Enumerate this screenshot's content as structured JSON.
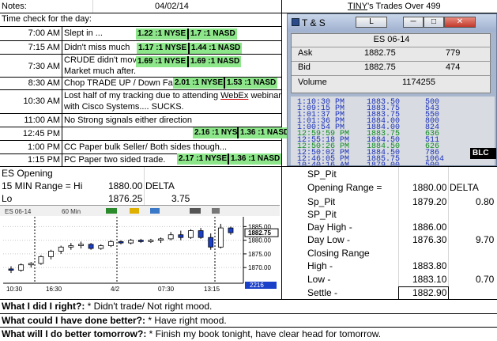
{
  "header": {
    "notes_label": "Notes:",
    "date": "04/02/14",
    "title_prefix": "TINY",
    "title_suffix": "'s Trades Over 499"
  },
  "time_check_label": "Time check for the day:",
  "log": [
    {
      "time": "7:00 AM",
      "note": "Slept in ...",
      "nyse": "1.22 :1 NYSE",
      "nasd": "1.7 :1 NASD"
    },
    {
      "time": "7:15 AM",
      "note": "Didn't miss much",
      "nyse": "1.17 :1 NYSE",
      "nasd": "1.44 :1 NASD"
    },
    {
      "time": "7:30 AM",
      "note": "CRUDE didn't move",
      "note2": "Market much after.",
      "nyse": "1.69 :1 NYSE",
      "nasd": "1.69 :1 NASD"
    },
    {
      "time": "8:30 AM",
      "note": "Chop TRADE UP / Down Fail",
      "nyse": "2.01 :1 NYSE",
      "nasd": "1.53 :1 NASD"
    },
    {
      "time": "10:30 AM",
      "note_a": "Lost half of my tracking due to attending ",
      "note_webex": "WebEx",
      "note_b": " webinar",
      "note2": "with Cisco Systems.... SUCKS."
    },
    {
      "time": "11:00 AM",
      "note": "No Strong signals either direction"
    },
    {
      "time": "12:45 PM",
      "nyse": "2.16 :1 NYSE",
      "nasd": "1.36 :1 NASD"
    },
    {
      "time": "1:00 PM",
      "note": "CC Paper bulk Seller/ Both sides though..."
    },
    {
      "time": "1:15 PM",
      "note": "PC Paper two sided trade.",
      "nyse": "2.17 :1 NYSE",
      "nasd": "1.36 :1 NASD"
    }
  ],
  "ts_window": {
    "title": "T & S",
    "btn_l": "L",
    "symbol": "ES 06-14",
    "ask_label": "Ask",
    "ask_price": "1882.75",
    "ask_size": "779",
    "bid_label": "Bid",
    "bid_price": "1882.75",
    "bid_size": "474",
    "volume_label": "Volume",
    "volume": "1174255",
    "blc_label": "BLC",
    "trades": [
      {
        "time": "1:10:30 PM",
        "price": "1883.50",
        "size": "500",
        "color": "#1a2fb8"
      },
      {
        "time": "1:09:15 PM",
        "price": "1883.75",
        "size": "543",
        "color": "#1a2fb8"
      },
      {
        "time": "1:01:37 PM",
        "price": "1883.75",
        "size": "550",
        "color": "#1a2fb8"
      },
      {
        "time": "1:01:36 PM",
        "price": "1884.00",
        "size": "800",
        "color": "#1a2fb8"
      },
      {
        "time": "1:00:54 PM",
        "price": "1884.00",
        "size": "824",
        "color": "#1a2fb8"
      },
      {
        "time": "12:59:59 PM",
        "price": "1883.75",
        "size": "636",
        "color": "#0c8a1e"
      },
      {
        "time": "12:55:18 PM",
        "price": "1884.50",
        "size": "511",
        "color": "#1a2fb8"
      },
      {
        "time": "12:50:26 PM",
        "price": "1884.50",
        "size": "626",
        "color": "#0c8a1e"
      },
      {
        "time": "12:50:02 PM",
        "price": "1884.50",
        "size": "786",
        "color": "#1a2fb8"
      },
      {
        "time": "12:46:05 PM",
        "price": "1885.75",
        "size": "1064",
        "color": "#1a2fb8"
      },
      {
        "time": "10:40:16 AM",
        "price": "1879.00",
        "size": "500",
        "color": "#1a2fb8"
      }
    ]
  },
  "es_block": {
    "title": "ES Opening",
    "range_label": "15 MIN Range = Hi",
    "hi": "1880.00",
    "delta_label": "DELTA",
    "lo_label": "Lo",
    "lo": "1876.25",
    "delta": "3.75"
  },
  "sp_block": {
    "sp_pit_1": "SP_Pit",
    "opening_range_label": "Opening Range =",
    "opening_range": "1880.00",
    "delta_label": "DELTA",
    "sp_pit_2": "Sp_Pit",
    "sp_pit_value": "1879.20",
    "sp_pit_delta": "0.80",
    "sp_pit_3": "SP_Pit",
    "day_high_label": "Day High -",
    "day_high": "1886.00",
    "day_low_label": "Day Low -",
    "day_low": "1876.30",
    "day_delta": "9.70",
    "closing_range_label": "Closing Range",
    "high_label": "High -",
    "high": "1883.80",
    "low_label": "Low -",
    "low": "1883.10",
    "close_delta": "0.70",
    "settle_label": "Settle -",
    "settle": "1882.90"
  },
  "chart_toolbar": {
    "symbol": "ES 06-14",
    "interval": "60 Min"
  },
  "chart_data": {
    "type": "candlestick",
    "symbol": "ES 06-14",
    "interval": "60 Min",
    "x_tick_labels": [
      "10:30",
      "16:30",
      "4/2",
      "07:30",
      "13:15"
    ],
    "y_tick_labels": [
      "1885.00",
      "1880.00",
      "1875.00",
      "1870.00"
    ],
    "last_price_label": "1882.75",
    "low_marker_label": "2216",
    "ylim": [
      1866,
      1888
    ],
    "candles": [
      {
        "o": 1869.5,
        "h": 1870.5,
        "l": 1868.0,
        "c": 1869.0
      },
      {
        "o": 1869.0,
        "h": 1871.5,
        "l": 1868.5,
        "c": 1871.0
      },
      {
        "o": 1871.0,
        "h": 1872.0,
        "l": 1870.0,
        "c": 1871.5
      },
      {
        "o": 1871.5,
        "h": 1874.5,
        "l": 1871.0,
        "c": 1874.0
      },
      {
        "o": 1874.0,
        "h": 1876.5,
        "l": 1873.0,
        "c": 1876.0
      },
      {
        "o": 1876.0,
        "h": 1878.0,
        "l": 1875.0,
        "c": 1877.5
      },
      {
        "o": 1877.5,
        "h": 1879.0,
        "l": 1876.5,
        "c": 1878.0
      },
      {
        "o": 1878.0,
        "h": 1879.5,
        "l": 1877.0,
        "c": 1878.5
      },
      {
        "o": 1878.5,
        "h": 1879.0,
        "l": 1876.5,
        "c": 1877.0
      },
      {
        "o": 1877.0,
        "h": 1878.5,
        "l": 1876.5,
        "c": 1878.0
      },
      {
        "o": 1878.0,
        "h": 1880.0,
        "l": 1877.5,
        "c": 1879.5
      },
      {
        "o": 1879.5,
        "h": 1880.0,
        "l": 1878.5,
        "c": 1879.0
      },
      {
        "o": 1879.0,
        "h": 1880.5,
        "l": 1878.5,
        "c": 1880.0
      },
      {
        "o": 1880.0,
        "h": 1880.5,
        "l": 1879.0,
        "c": 1879.5
      },
      {
        "o": 1879.5,
        "h": 1880.5,
        "l": 1879.0,
        "c": 1880.0
      },
      {
        "o": 1880.0,
        "h": 1881.0,
        "l": 1879.0,
        "c": 1880.5
      },
      {
        "o": 1880.5,
        "h": 1883.0,
        "l": 1880.0,
        "c": 1882.0
      },
      {
        "o": 1882.0,
        "h": 1883.5,
        "l": 1880.0,
        "c": 1881.0
      },
      {
        "o": 1881.0,
        "h": 1884.0,
        "l": 1880.5,
        "c": 1883.5
      },
      {
        "o": 1883.5,
        "h": 1884.5,
        "l": 1880.5,
        "c": 1881.0
      },
      {
        "o": 1881.0,
        "h": 1882.5,
        "l": 1876.5,
        "c": 1877.5
      },
      {
        "o": 1877.5,
        "h": 1886.0,
        "l": 1877.0,
        "c": 1884.5
      },
      {
        "o": 1884.5,
        "h": 1885.0,
        "l": 1882.0,
        "c": 1882.75
      }
    ]
  },
  "review": {
    "q1": "What I did I right?:",
    "a1": " * Didn't trade/ Not right mood.",
    "q2": "What could I have done better?:",
    "a2": " * Have right mood.",
    "q3": "What will I do better tomorrow?:",
    "a3": " * Finish my book tonight, have clear head for tomorrow."
  }
}
